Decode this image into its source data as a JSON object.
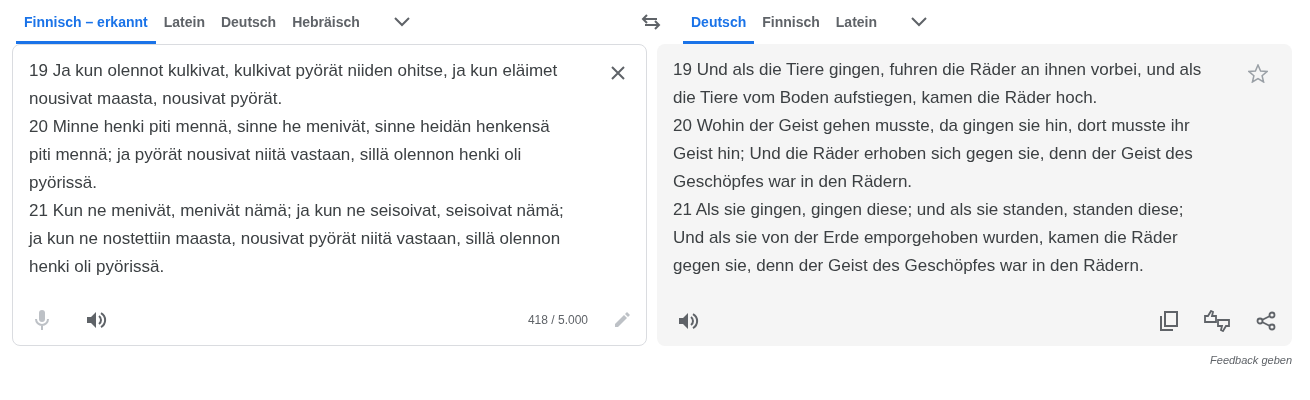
{
  "source_tabs": [
    {
      "label": "Finnisch – erkannt",
      "selected": true
    },
    {
      "label": "Latein",
      "selected": false
    },
    {
      "label": "Deutsch",
      "selected": false
    },
    {
      "label": "Hebräisch",
      "selected": false
    }
  ],
  "target_tabs": [
    {
      "label": "Deutsch",
      "selected": true
    },
    {
      "label": "Finnisch",
      "selected": false
    },
    {
      "label": "Latein",
      "selected": false
    }
  ],
  "source": {
    "lines": [
      "19 Ja kun olennot kulkivat, kulkivat pyörät niiden ohitse, ja kun eläimet",
      "nousivat maasta, nousivat pyörät.",
      "20 Minne henki piti mennä, sinne he menivät, sinne heidän henkensä",
      "piti mennä; ja pyörät nousivat niitä vastaan, sillä olennon henki oli",
      "pyörissä.",
      "21 Kun ne menivät, menivät nämä; ja kun ne seisoivat, seisoivat nämä;",
      "ja kun ne nostettiin maasta, nousivat pyörät niitä vastaan, sillä olennon",
      "henki oli pyörissä."
    ],
    "char_count": "418 / 5.000"
  },
  "target": {
    "lines": [
      "19 Und als die Tiere gingen, fuhren die Räder an ihnen vorbei, und als",
      "die Tiere vom Boden aufstiegen, kamen die Räder hoch.",
      "20 Wohin der Geist gehen musste, da gingen sie hin, dort musste ihr",
      "Geist hin; Und die Räder erhoben sich gegen sie, denn der Geist des",
      "Geschöpfes war in den Rädern.",
      "21 Als sie gingen, gingen diese; und als sie standen, standen diese;",
      "Und als sie von der Erde emporgehoben wurden, kamen die Räder",
      "gegen sie, denn der Geist des Geschöpfes war in den Rädern."
    ]
  },
  "feedback": "Feedback geben"
}
